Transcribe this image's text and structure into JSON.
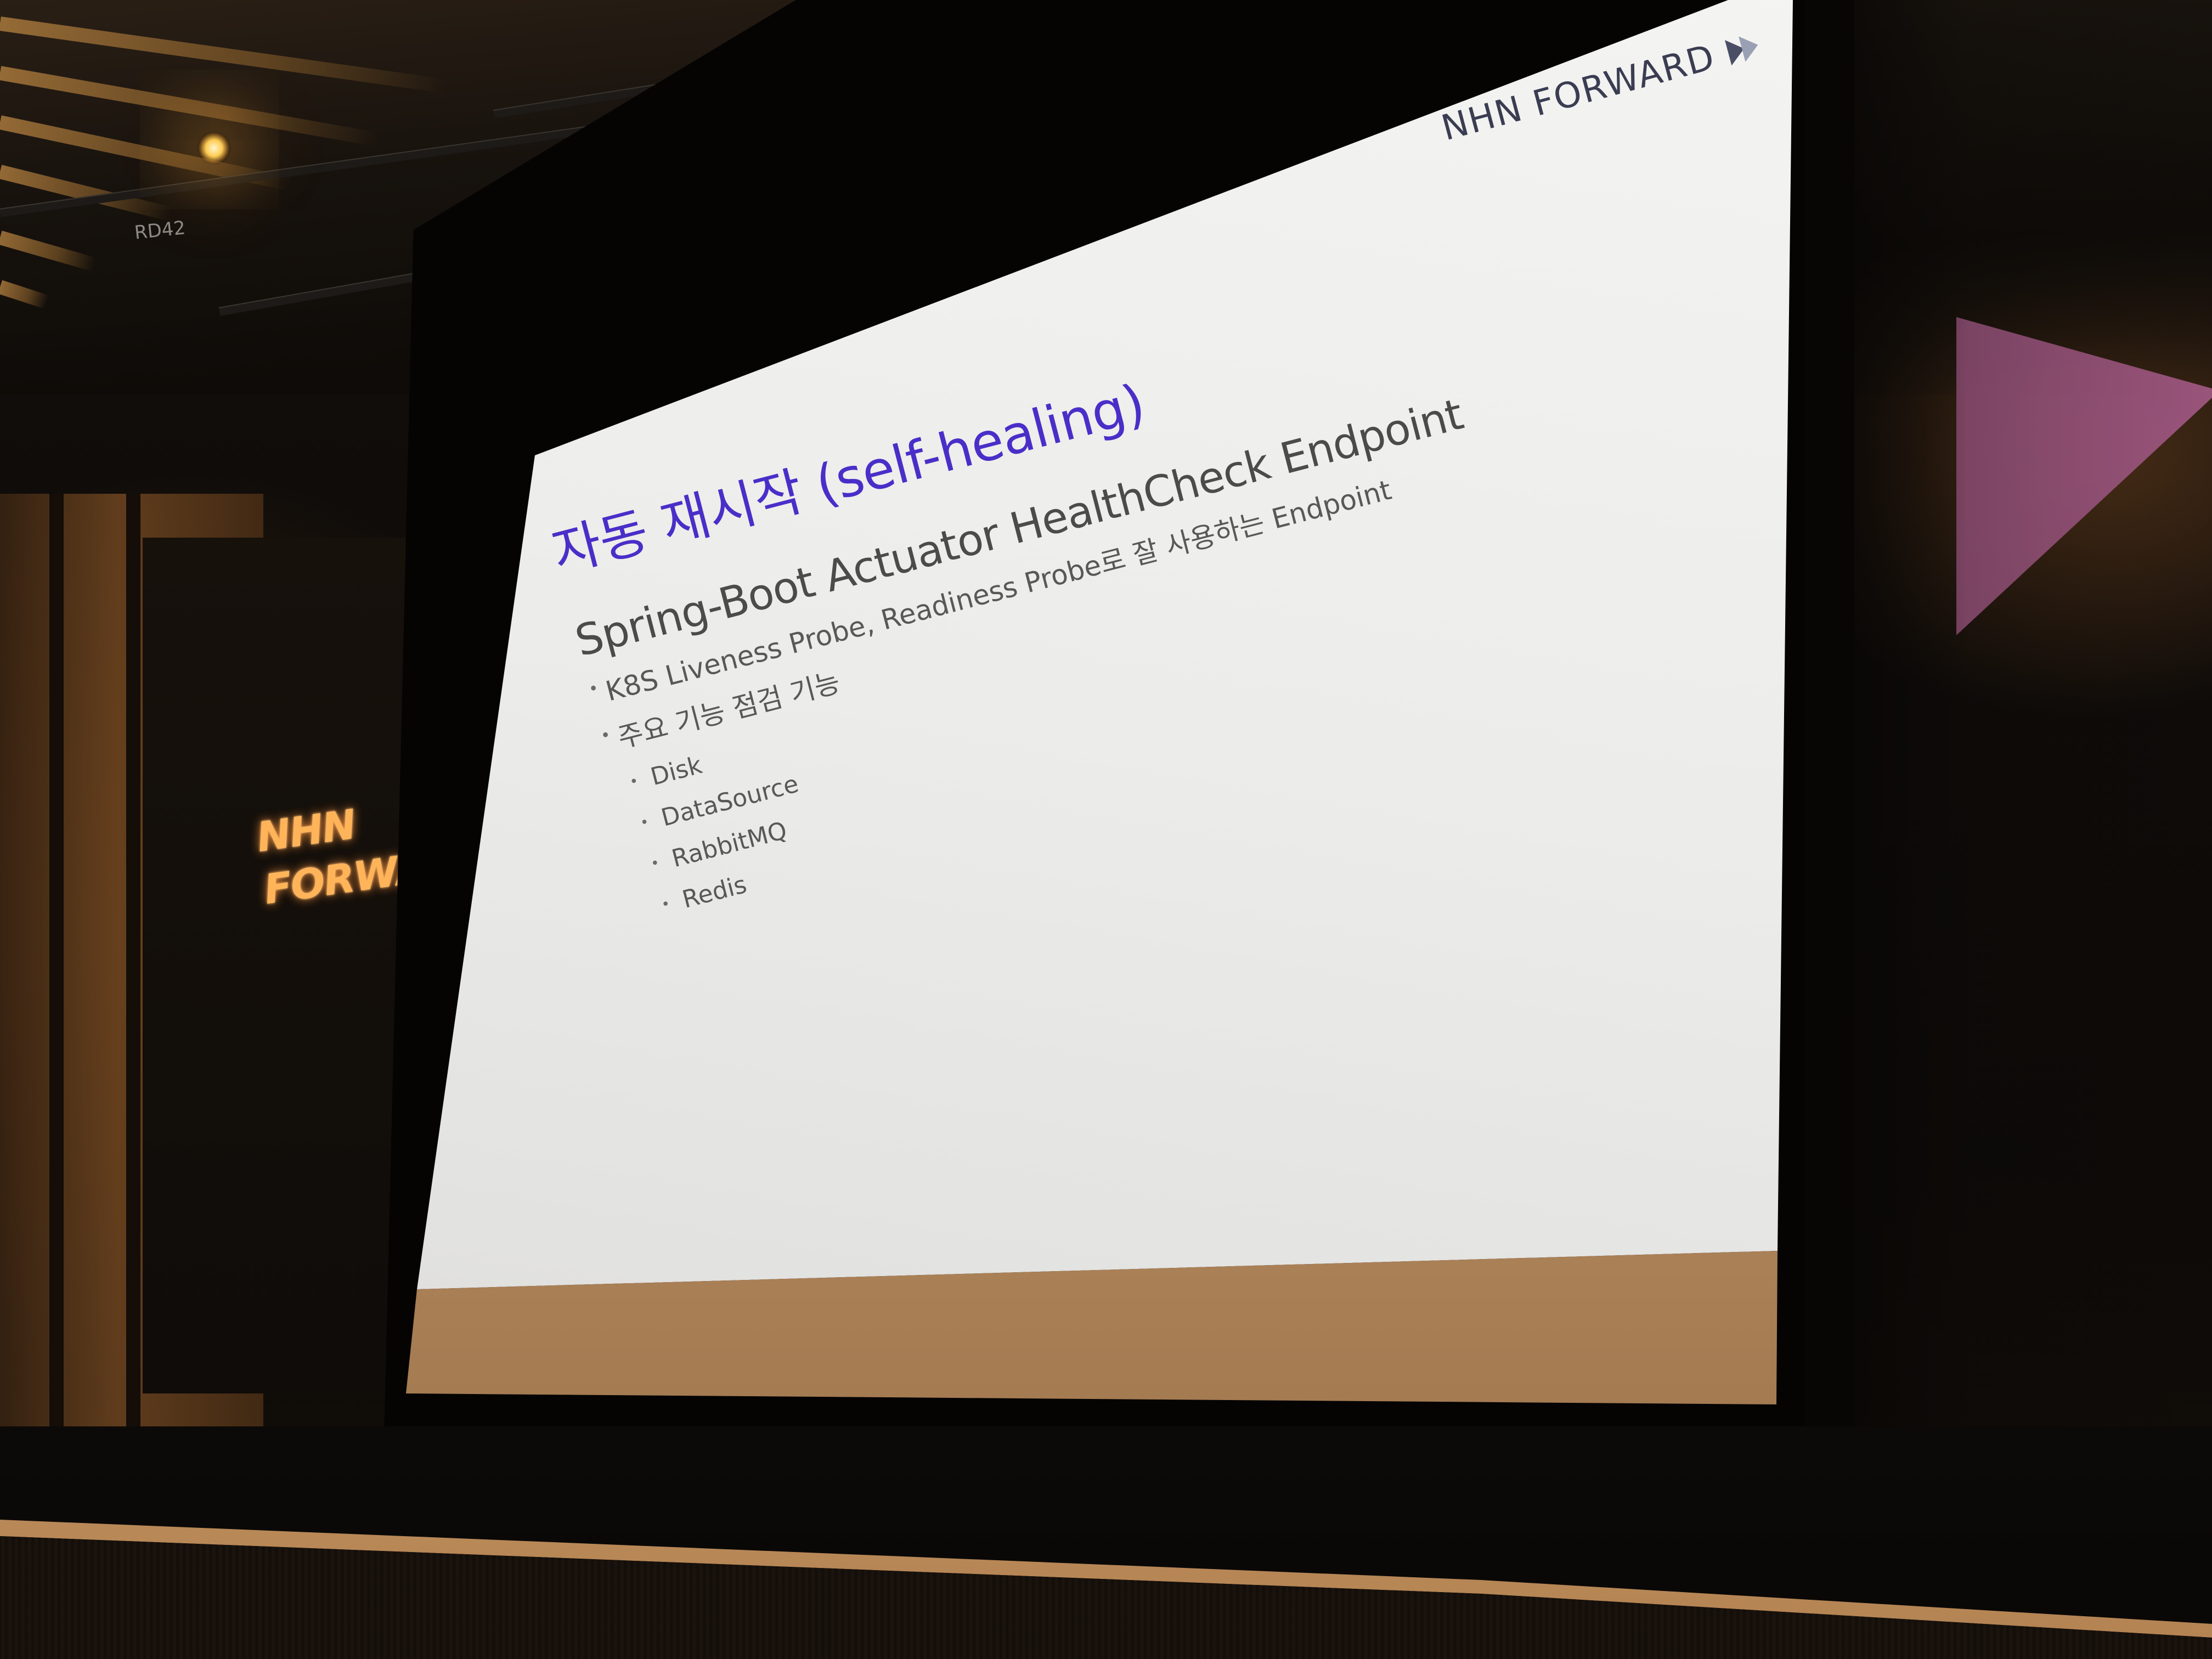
{
  "rig_label": "RD42",
  "venue_sign": {
    "line1": "NHN",
    "line2": "FORWARD",
    "glow_color": "#ffb45a",
    "arrow_color": "#c06ab0"
  },
  "slide": {
    "brand": "NHN FORWARD",
    "title": "자동 재시작 (self-healing)",
    "heading": "Spring-Boot Actuator HealthCheck Endpoint",
    "bullets": [
      "K8S Liveness Probe, Readiness Probe로 잘 사용하는 Endpoint",
      "주요 기능 점검 기능"
    ],
    "sub_bullets": [
      "Disk",
      "DataSource",
      "RabbitMQ",
      "Redis"
    ],
    "title_color": "#4a2ec8",
    "text_color": "#4b4b4b"
  },
  "decoration": {
    "triangle_color": "#a45a86"
  }
}
